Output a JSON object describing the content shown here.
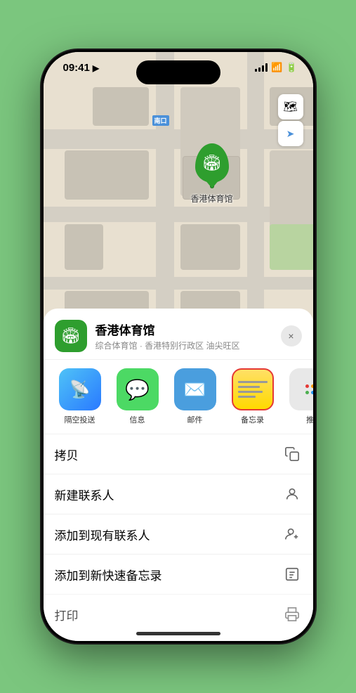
{
  "status_bar": {
    "time": "09:41",
    "location_arrow": "▶"
  },
  "map": {
    "label_badge": "南口",
    "marker_label": "香港体育馆",
    "controls": {
      "map_type": "🗺",
      "location": "➤"
    }
  },
  "bottom_sheet": {
    "title": "香港体育馆",
    "subtitle": "综合体育馆 · 香港特别行政区 油尖旺区",
    "close_label": "×",
    "share_items": [
      {
        "id": "airdrop",
        "label": "隔空投送"
      },
      {
        "id": "messages",
        "label": "信息"
      },
      {
        "id": "mail",
        "label": "邮件"
      },
      {
        "id": "notes",
        "label": "备忘录"
      },
      {
        "id": "more",
        "label": "推"
      }
    ],
    "actions": [
      {
        "id": "copy",
        "label": "拷贝"
      },
      {
        "id": "new-contact",
        "label": "新建联系人"
      },
      {
        "id": "add-existing",
        "label": "添加到现有联系人"
      },
      {
        "id": "add-notes",
        "label": "添加到新快速备忘录"
      },
      {
        "id": "print",
        "label": "打印"
      }
    ]
  }
}
